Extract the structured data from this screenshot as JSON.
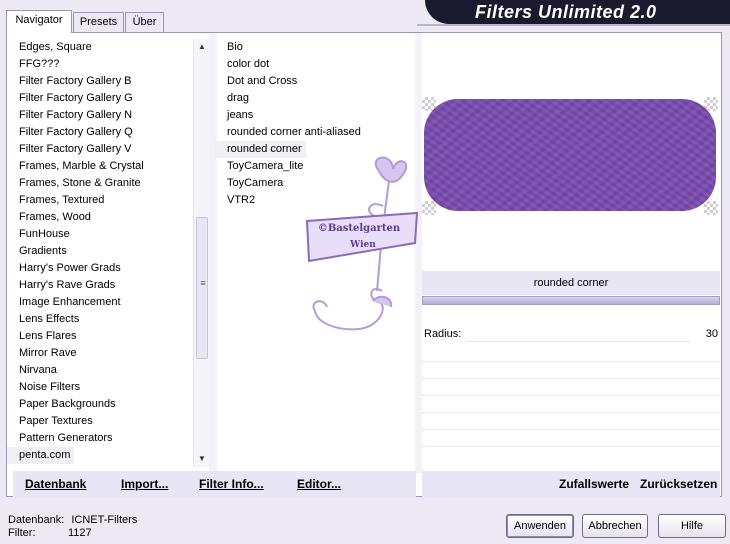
{
  "app": {
    "title": "Filters Unlimited 2.0",
    "accent_color": "#7a4bb0",
    "banner_color": "#1a1a2e"
  },
  "tabs": [
    {
      "label": "Navigator",
      "active": true
    },
    {
      "label": "Presets",
      "active": false
    },
    {
      "label": "Über",
      "active": false
    }
  ],
  "categories": {
    "items": [
      "Edges, Square",
      "FFG???",
      "Filter Factory Gallery B",
      "Filter Factory Gallery G",
      "Filter Factory Gallery N",
      "Filter Factory Gallery Q",
      "Filter Factory Gallery V",
      "Frames, Marble & Crystal",
      "Frames, Stone & Granite",
      "Frames, Textured",
      "Frames, Wood",
      "FunHouse",
      "Gradients",
      "Harry's Power Grads",
      "Harry's Rave Grads",
      "Image Enhancement",
      "Lens Effects",
      "Lens Flares",
      "Mirror Rave",
      "Nirvana",
      "Noise Filters",
      "Paper Backgrounds",
      "Paper Textures",
      "Pattern Generators",
      "penta.com"
    ],
    "selected": "penta.com"
  },
  "filters": {
    "items": [
      "Bio",
      "color dot",
      "Dot and Cross",
      "drag",
      "jeans",
      "rounded corner anti-aliased",
      "rounded corner",
      "ToyCamera_lite",
      "ToyCamera",
      "VTR2"
    ],
    "selected": "rounded corner"
  },
  "left_toolbar": {
    "database": "Datenbank",
    "import": "Import...",
    "filter_info": "Filter Info...",
    "editor": "Editor..."
  },
  "right_toolbar": {
    "random": "Zufallswerte",
    "reset": "Zurücksetzen"
  },
  "preview": {
    "filter_name": "rounded corner",
    "shape_color": "#7a4bb0"
  },
  "params": [
    {
      "label": "Radius:",
      "value": "30"
    }
  ],
  "watermark": {
    "line1": "©Bastelgarten",
    "line2": "Wien"
  },
  "status": {
    "db_label": "Datenbank:",
    "db_value": "ICNET-Filters",
    "filter_label": "Filter:",
    "filter_value": "1127"
  },
  "buttons": {
    "apply": "Anwenden",
    "cancel": "Abbrechen",
    "help": "Hilfe"
  }
}
